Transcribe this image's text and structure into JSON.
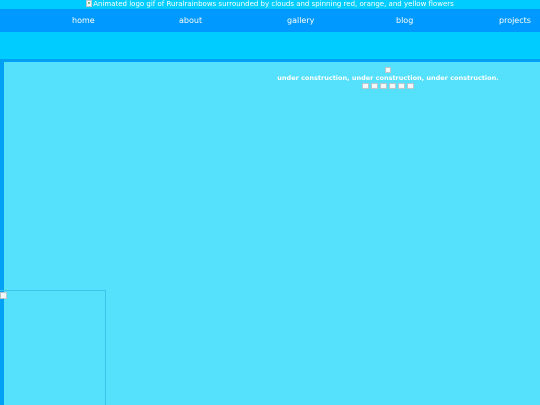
{
  "header": {
    "logo_alt": "Animated logo gif of Ruralrainbows surrounded by clouds and spinning red, orange, and yellow flowers"
  },
  "nav": {
    "items": [
      {
        "label": "home"
      },
      {
        "label": "about"
      },
      {
        "label": "gallery"
      },
      {
        "label": "blog"
      },
      {
        "label": "projects"
      }
    ]
  },
  "main": {
    "construction_text": "under construction, under construction, under construction."
  },
  "colors": {
    "page_bg": "#00ccff",
    "nav_bg": "#0099ff",
    "content_bg": "#55e1fb",
    "text": "#ffffff"
  }
}
